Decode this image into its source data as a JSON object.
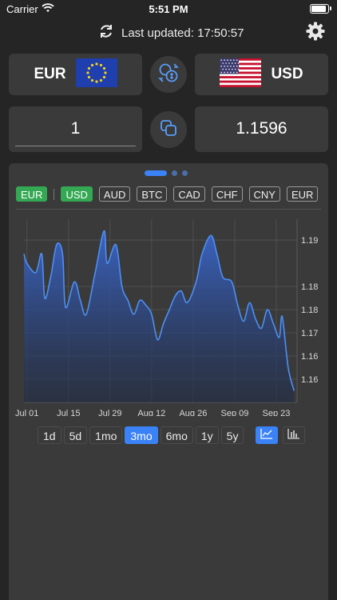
{
  "status_bar": {
    "carrier": "Carrier",
    "time": "5:51 PM",
    "battery_level": 1.0
  },
  "header": {
    "last_updated": "Last updated: 17:50:57"
  },
  "converter": {
    "from": {
      "code": "EUR",
      "flag": "eu-flag"
    },
    "to": {
      "code": "USD",
      "flag": "us-flag"
    },
    "amount": "1",
    "result": "1.1596"
  },
  "carousel": {
    "pages": 3,
    "active": 0
  },
  "base_chip": "EUR",
  "currency_chips": [
    "USD",
    "AUD",
    "BTC",
    "CAD",
    "CHF",
    "CNY",
    "EUR"
  ],
  "selected_chip": "USD",
  "time_ranges": [
    "1d",
    "5d",
    "1mo",
    "3mo",
    "6mo",
    "1y",
    "5y"
  ],
  "selected_range": "3mo",
  "chart_types": [
    "line-chart-icon",
    "bar-chart-icon"
  ],
  "selected_chart_type": "line-chart-icon",
  "colors": {
    "accent": "#3a82f6",
    "chip_selected": "#34a853",
    "card": "#3a3a3a",
    "background": "#252525"
  },
  "chart_data": {
    "type": "area",
    "series": [
      {
        "name": "EUR/USD",
        "x": [
          "2023-06-30",
          "2023-07-01",
          "2023-07-04",
          "2023-07-06",
          "2023-07-07",
          "2023-07-09",
          "2023-07-11",
          "2023-07-13",
          "2023-07-14",
          "2023-07-17",
          "2023-07-19",
          "2023-07-21",
          "2023-07-24",
          "2023-07-27",
          "2023-07-28",
          "2023-07-31",
          "2023-08-02",
          "2023-08-04",
          "2023-08-06",
          "2023-08-08",
          "2023-08-10",
          "2023-08-12",
          "2023-08-14",
          "2023-08-16",
          "2023-08-18",
          "2023-08-20",
          "2023-08-22",
          "2023-08-24",
          "2023-08-27",
          "2023-08-29",
          "2023-09-01",
          "2023-09-03",
          "2023-09-05",
          "2023-09-08",
          "2023-09-10",
          "2023-09-12",
          "2023-09-14",
          "2023-09-16",
          "2023-09-18",
          "2023-09-20",
          "2023-09-22",
          "2023-09-24",
          "2023-09-25",
          "2023-09-27",
          "2023-09-29"
        ],
        "values": [
          1.187,
          1.185,
          1.183,
          1.187,
          1.1775,
          1.182,
          1.189,
          1.187,
          1.1755,
          1.181,
          1.177,
          1.174,
          1.183,
          1.192,
          1.185,
          1.189,
          1.18,
          1.177,
          1.174,
          1.177,
          1.176,
          1.174,
          1.1685,
          1.172,
          1.175,
          1.178,
          1.179,
          1.1765,
          1.181,
          1.187,
          1.191,
          1.187,
          1.182,
          1.181,
          1.176,
          1.1725,
          1.1765,
          1.173,
          1.171,
          1.175,
          1.172,
          1.169,
          1.1735,
          1.1625,
          1.1575
        ]
      }
    ],
    "ylim": [
      1.155,
      1.1945
    ],
    "ytick_labels": [
      "1.19",
      "1.18",
      "1.18",
      "1.17",
      "1.16",
      "1.16"
    ],
    "ytick_values": [
      1.19,
      1.18,
      1.175,
      1.17,
      1.165,
      1.16
    ],
    "xtick_labels": [
      "Jul 01",
      "Jul 15",
      "Jul 29",
      "Aug 12",
      "Aug 26",
      "Sep 09",
      "Sep 23"
    ],
    "xtick_values": [
      "2023-07-01",
      "2023-07-15",
      "2023-07-29",
      "2023-08-12",
      "2023-08-26",
      "2023-09-09",
      "2023-09-23"
    ],
    "grid": true
  }
}
